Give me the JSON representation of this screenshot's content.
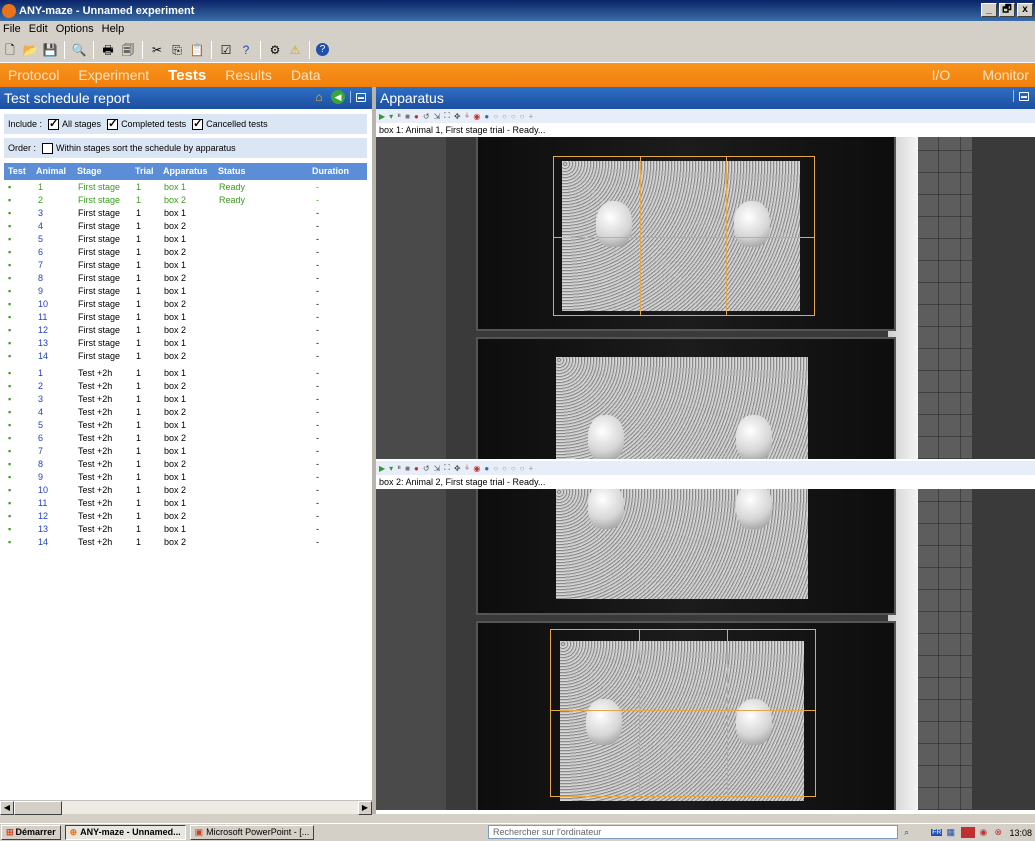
{
  "window": {
    "title": "ANY-maze - Unnamed experiment",
    "min": "_",
    "max": "🗗",
    "close": "x"
  },
  "menu": [
    "File",
    "Edit",
    "Options",
    "Help"
  ],
  "nav": {
    "tabs": [
      "Protocol",
      "Experiment",
      "Tests",
      "Results",
      "Data"
    ],
    "active": "Tests",
    "right": [
      "I/O",
      "Monitor"
    ]
  },
  "report": {
    "title": "Test schedule report",
    "include_label": "Include :",
    "all_stages": "All stages",
    "completed_tests": "Completed tests",
    "cancelled_tests": "Cancelled tests",
    "order_label": "Order :",
    "order_option": "Within stages sort the schedule by apparatus",
    "columns": {
      "test": "Test",
      "animal": "Animal",
      "stage": "Stage",
      "trial": "Trial",
      "apparatus": "Apparatus",
      "status": "Status",
      "duration": "Duration"
    },
    "rows": [
      {
        "dot": "▪",
        "animal": "1",
        "stage": "First stage",
        "trial": "1",
        "apparatus": "box 1",
        "status": "Ready",
        "duration": "-"
      },
      {
        "dot": "▪",
        "animal": "2",
        "stage": "First stage",
        "trial": "1",
        "apparatus": "box 2",
        "status": "Ready",
        "duration": "-"
      },
      {
        "dot": "▪",
        "animal": "3",
        "stage": "First stage",
        "trial": "1",
        "apparatus": "box 1",
        "status": "",
        "duration": "-"
      },
      {
        "dot": "▪",
        "animal": "4",
        "stage": "First stage",
        "trial": "1",
        "apparatus": "box 2",
        "status": "",
        "duration": "-"
      },
      {
        "dot": "▪",
        "animal": "5",
        "stage": "First stage",
        "trial": "1",
        "apparatus": "box 1",
        "status": "",
        "duration": "-"
      },
      {
        "dot": "▪",
        "animal": "6",
        "stage": "First stage",
        "trial": "1",
        "apparatus": "box 2",
        "status": "",
        "duration": "-"
      },
      {
        "dot": "▪",
        "animal": "7",
        "stage": "First stage",
        "trial": "1",
        "apparatus": "box 1",
        "status": "",
        "duration": "-"
      },
      {
        "dot": "▪",
        "animal": "8",
        "stage": "First stage",
        "trial": "1",
        "apparatus": "box 2",
        "status": "",
        "duration": "-"
      },
      {
        "dot": "▪",
        "animal": "9",
        "stage": "First stage",
        "trial": "1",
        "apparatus": "box 1",
        "status": "",
        "duration": "-"
      },
      {
        "dot": "▪",
        "animal": "10",
        "stage": "First stage",
        "trial": "1",
        "apparatus": "box 2",
        "status": "",
        "duration": "-"
      },
      {
        "dot": "▪",
        "animal": "11",
        "stage": "First stage",
        "trial": "1",
        "apparatus": "box 1",
        "status": "",
        "duration": "-"
      },
      {
        "dot": "▪",
        "animal": "12",
        "stage": "First stage",
        "trial": "1",
        "apparatus": "box 2",
        "status": "",
        "duration": "-"
      },
      {
        "dot": "▪",
        "animal": "13",
        "stage": "First stage",
        "trial": "1",
        "apparatus": "box 1",
        "status": "",
        "duration": "-"
      },
      {
        "dot": "▪",
        "animal": "14",
        "stage": "First stage",
        "trial": "1",
        "apparatus": "box 2",
        "status": "",
        "duration": "-"
      },
      {
        "dot": "▪",
        "animal": "1",
        "stage": "Test +2h",
        "trial": "1",
        "apparatus": "box 1",
        "status": "",
        "duration": "-"
      },
      {
        "dot": "▪",
        "animal": "2",
        "stage": "Test +2h",
        "trial": "1",
        "apparatus": "box 2",
        "status": "",
        "duration": "-"
      },
      {
        "dot": "▪",
        "animal": "3",
        "stage": "Test +2h",
        "trial": "1",
        "apparatus": "box 1",
        "status": "",
        "duration": "-"
      },
      {
        "dot": "▪",
        "animal": "4",
        "stage": "Test +2h",
        "trial": "1",
        "apparatus": "box 2",
        "status": "",
        "duration": "-"
      },
      {
        "dot": "▪",
        "animal": "5",
        "stage": "Test +2h",
        "trial": "1",
        "apparatus": "box 1",
        "status": "",
        "duration": "-"
      },
      {
        "dot": "▪",
        "animal": "6",
        "stage": "Test +2h",
        "trial": "1",
        "apparatus": "box 2",
        "status": "",
        "duration": "-"
      },
      {
        "dot": "▪",
        "animal": "7",
        "stage": "Test +2h",
        "trial": "1",
        "apparatus": "box 1",
        "status": "",
        "duration": "-"
      },
      {
        "dot": "▪",
        "animal": "8",
        "stage": "Test +2h",
        "trial": "1",
        "apparatus": "box 2",
        "status": "",
        "duration": "-"
      },
      {
        "dot": "▪",
        "animal": "9",
        "stage": "Test +2h",
        "trial": "1",
        "apparatus": "box 1",
        "status": "",
        "duration": "-"
      },
      {
        "dot": "▪",
        "animal": "10",
        "stage": "Test +2h",
        "trial": "1",
        "apparatus": "box 2",
        "status": "",
        "duration": "-"
      },
      {
        "dot": "▪",
        "animal": "11",
        "stage": "Test +2h",
        "trial": "1",
        "apparatus": "box 1",
        "status": "",
        "duration": "-"
      },
      {
        "dot": "▪",
        "animal": "12",
        "stage": "Test +2h",
        "trial": "1",
        "apparatus": "box 2",
        "status": "",
        "duration": "-"
      },
      {
        "dot": "▪",
        "animal": "13",
        "stage": "Test +2h",
        "trial": "1",
        "apparatus": "box 1",
        "status": "",
        "duration": "-"
      },
      {
        "dot": "▪",
        "animal": "14",
        "stage": "Test +2h",
        "trial": "1",
        "apparatus": "box 2",
        "status": "",
        "duration": "-"
      }
    ]
  },
  "apparatus": {
    "title": "Apparatus",
    "box1_caption": "box 1: Animal 1, First stage trial - Ready...",
    "box2_caption": "box 2: Animal 2, First stage trial - Ready..."
  },
  "taskbar": {
    "start": "Démarrer",
    "tasks": [
      "ANY-maze - Unnamed...",
      "Microsoft PowerPoint - [..."
    ],
    "search_placeholder": "Rechercher sur l'ordinateur",
    "lang": "FR",
    "clock": "13:08"
  },
  "colors": {
    "nav_orange": "#f7941d",
    "panel_blue": "#2e6fc4",
    "ready_green": "#3a9c1c",
    "animal_blue": "#1f3fbf",
    "zone_orange": "#e6a64c"
  }
}
